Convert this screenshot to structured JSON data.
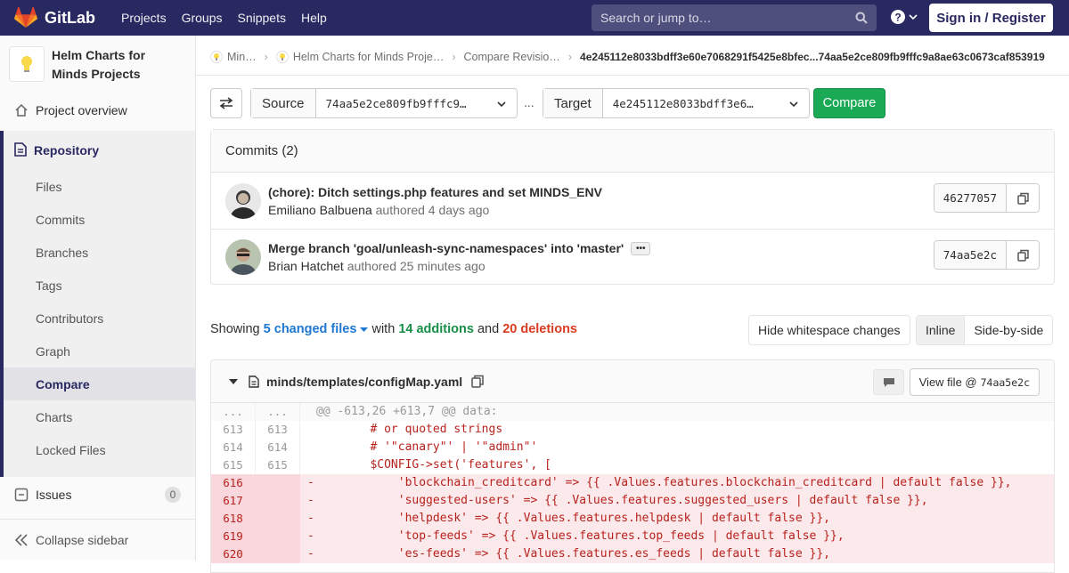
{
  "navbar": {
    "brand": "GitLab",
    "links": [
      "Projects",
      "Groups",
      "Snippets",
      "Help"
    ],
    "search_placeholder": "Search or jump to…",
    "signin": "Sign in / Register"
  },
  "sidebar": {
    "project_name": "Helm Charts for Minds Projects",
    "overview": "Project overview",
    "repository": "Repository",
    "items": [
      "Files",
      "Commits",
      "Branches",
      "Tags",
      "Contributors",
      "Graph",
      "Compare",
      "Charts",
      "Locked Files"
    ],
    "active_item": "Compare",
    "issues": "Issues",
    "issues_count": "0",
    "collapse": "Collapse sidebar"
  },
  "breadcrumb": {
    "group": "Min…",
    "project": "Helm Charts for Minds Proje…",
    "section": "Compare Revisio…",
    "current": "4e245112e8033bdff3e60e7068291f5425e8bfec...74aa5e2ce809fb9fffc9a8ae63c0673caf853919"
  },
  "compare": {
    "source_label": "Source",
    "source_value": "74aa5e2ce809fb9fffc9…",
    "separator": "...",
    "target_label": "Target",
    "target_value": "4e245112e8033bdff3e6…",
    "button": "Compare"
  },
  "commits": {
    "header": "Commits (2)",
    "list": [
      {
        "title": "(chore): Ditch settings.php features and set MINDS_ENV",
        "author": "Emiliano Balbuena",
        "authored": "authored 4 days ago",
        "sha": "46277057"
      },
      {
        "title": "Merge branch 'goal/unleash-sync-namespaces' into 'master'",
        "author": "Brian Hatchet",
        "authored": "authored 25 minutes ago",
        "sha": "74aa5e2c"
      }
    ]
  },
  "summary": {
    "showing": "Showing",
    "files": "5 changed files",
    "with": "with",
    "additions": "14 additions",
    "and": "and",
    "deletions": "20 deletions",
    "hide_ws": "Hide whitespace changes",
    "inline": "Inline",
    "side_by_side": "Side-by-side"
  },
  "file": {
    "path": "minds/templates/configMap.yaml",
    "view_label": "View file @",
    "view_sha": "74aa5e2c",
    "lines": [
      {
        "type": "hunk",
        "old": "...",
        "new": "...",
        "code": "@@ -613,26 +613,7 @@ data:"
      },
      {
        "type": "ctx",
        "old": "613",
        "new": "613",
        "code": "         # or quoted strings"
      },
      {
        "type": "ctx",
        "old": "614",
        "new": "614",
        "code": "         # '\"canary\"' | '\"admin\"'"
      },
      {
        "type": "ctx",
        "old": "615",
        "new": "615",
        "code": "         $CONFIG->set('features', ["
      },
      {
        "type": "del",
        "old": "616",
        "new": "",
        "code": "-            'blockchain_creditcard' => {{ .Values.features.blockchain_creditcard | default false }},"
      },
      {
        "type": "del",
        "old": "617",
        "new": "",
        "code": "-            'suggested-users' => {{ .Values.features.suggested_users | default false }},"
      },
      {
        "type": "del",
        "old": "618",
        "new": "",
        "code": "-            'helpdesk' => {{ .Values.features.helpdesk | default false }},"
      },
      {
        "type": "del",
        "old": "619",
        "new": "",
        "code": "-            'top-feeds' => {{ .Values.features.top_feeds | default false }},"
      },
      {
        "type": "del",
        "old": "620",
        "new": "",
        "code": "-            'es-feeds' => {{ .Values.features.es_feeds | default false }},"
      }
    ]
  }
}
